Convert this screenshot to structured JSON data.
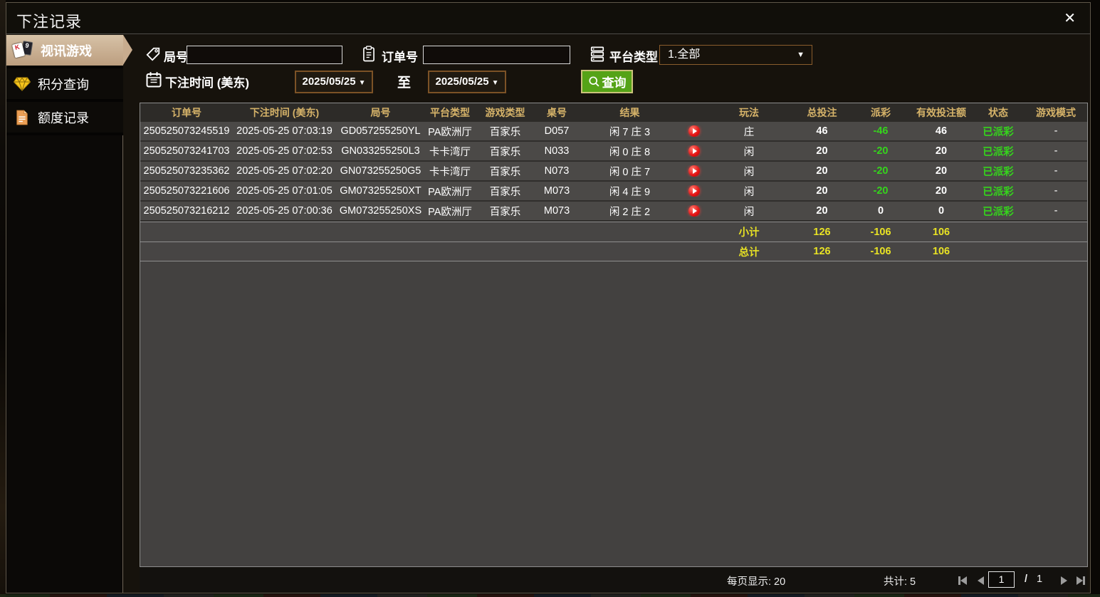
{
  "dialog": {
    "title": "下注记录"
  },
  "icons": {
    "close": "✕",
    "caret_down": "▼",
    "card_left": "K",
    "card_right": "9"
  },
  "sidebar": {
    "items": [
      {
        "label": "视讯游戏"
      },
      {
        "label": "积分查询"
      },
      {
        "label": "额度记录"
      }
    ]
  },
  "filters": {
    "round": {
      "label": "局号",
      "value": ""
    },
    "order": {
      "label": "订单号",
      "value": ""
    },
    "platform": {
      "label": "平台类型",
      "value": "1.全部"
    },
    "bet_time": {
      "label": "下注时间 (美东)",
      "from": "2025/05/25",
      "to_label": "至",
      "to": "2025/05/25"
    },
    "query_label": "查询"
  },
  "table": {
    "columns": [
      "订单号",
      "下注时间 (美东)",
      "局号",
      "平台类型",
      "游戏类型",
      "桌号",
      "结果",
      "",
      "玩法",
      "总投注",
      "派彩",
      "有效投注额",
      "状态",
      "游戏模式"
    ],
    "rows": [
      [
        "250525073245519",
        "2025-05-25 07:03:19",
        "GD057255250YL",
        "PA欧洲厅",
        "百家乐",
        "D057",
        "闲 7 庄 3",
        "",
        "庄",
        "46",
        "-46",
        "46",
        "已派彩",
        "-"
      ],
      [
        "250525073241703",
        "2025-05-25 07:02:53",
        "GN033255250L3",
        "卡卡湾厅",
        "百家乐",
        "N033",
        "闲 0 庄 8",
        "",
        "闲",
        "20",
        "-20",
        "20",
        "已派彩",
        "-"
      ],
      [
        "250525073235362",
        "2025-05-25 07:02:20",
        "GN073255250G5",
        "卡卡湾厅",
        "百家乐",
        "N073",
        "闲 0 庄 7",
        "",
        "闲",
        "20",
        "-20",
        "20",
        "已派彩",
        "-"
      ],
      [
        "250525073221606",
        "2025-05-25 07:01:05",
        "GM073255250XT",
        "PA欧洲厅",
        "百家乐",
        "M073",
        "闲 4 庄 9",
        "",
        "闲",
        "20",
        "-20",
        "20",
        "已派彩",
        "-"
      ],
      [
        "250525073216212",
        "2025-05-25 07:00:36",
        "GM073255250XS",
        "PA欧洲厅",
        "百家乐",
        "M073",
        "闲 2 庄 2",
        "",
        "闲",
        "20",
        "0",
        "0",
        "已派彩",
        "-"
      ]
    ],
    "subtotal": {
      "label": "小计",
      "total_bet": "126",
      "payout": "-106",
      "valid_bet": "106"
    },
    "grand_total": {
      "label": "总计",
      "total_bet": "126",
      "payout": "-106",
      "valid_bet": "106"
    }
  },
  "footer": {
    "page_size_label": "每页显示: 20",
    "total_label": "共计: 5",
    "page_current": "1",
    "page_divider": "/",
    "page_total": "1"
  },
  "colors": {
    "accent_tan": "#c8b094",
    "header_gold": "#d6b369",
    "positive_green": "#35d41c",
    "summary_yellow": "#e8e224",
    "query_green": "#55a317",
    "row_gray": "#4b4947",
    "play_red": "#e31313"
  }
}
